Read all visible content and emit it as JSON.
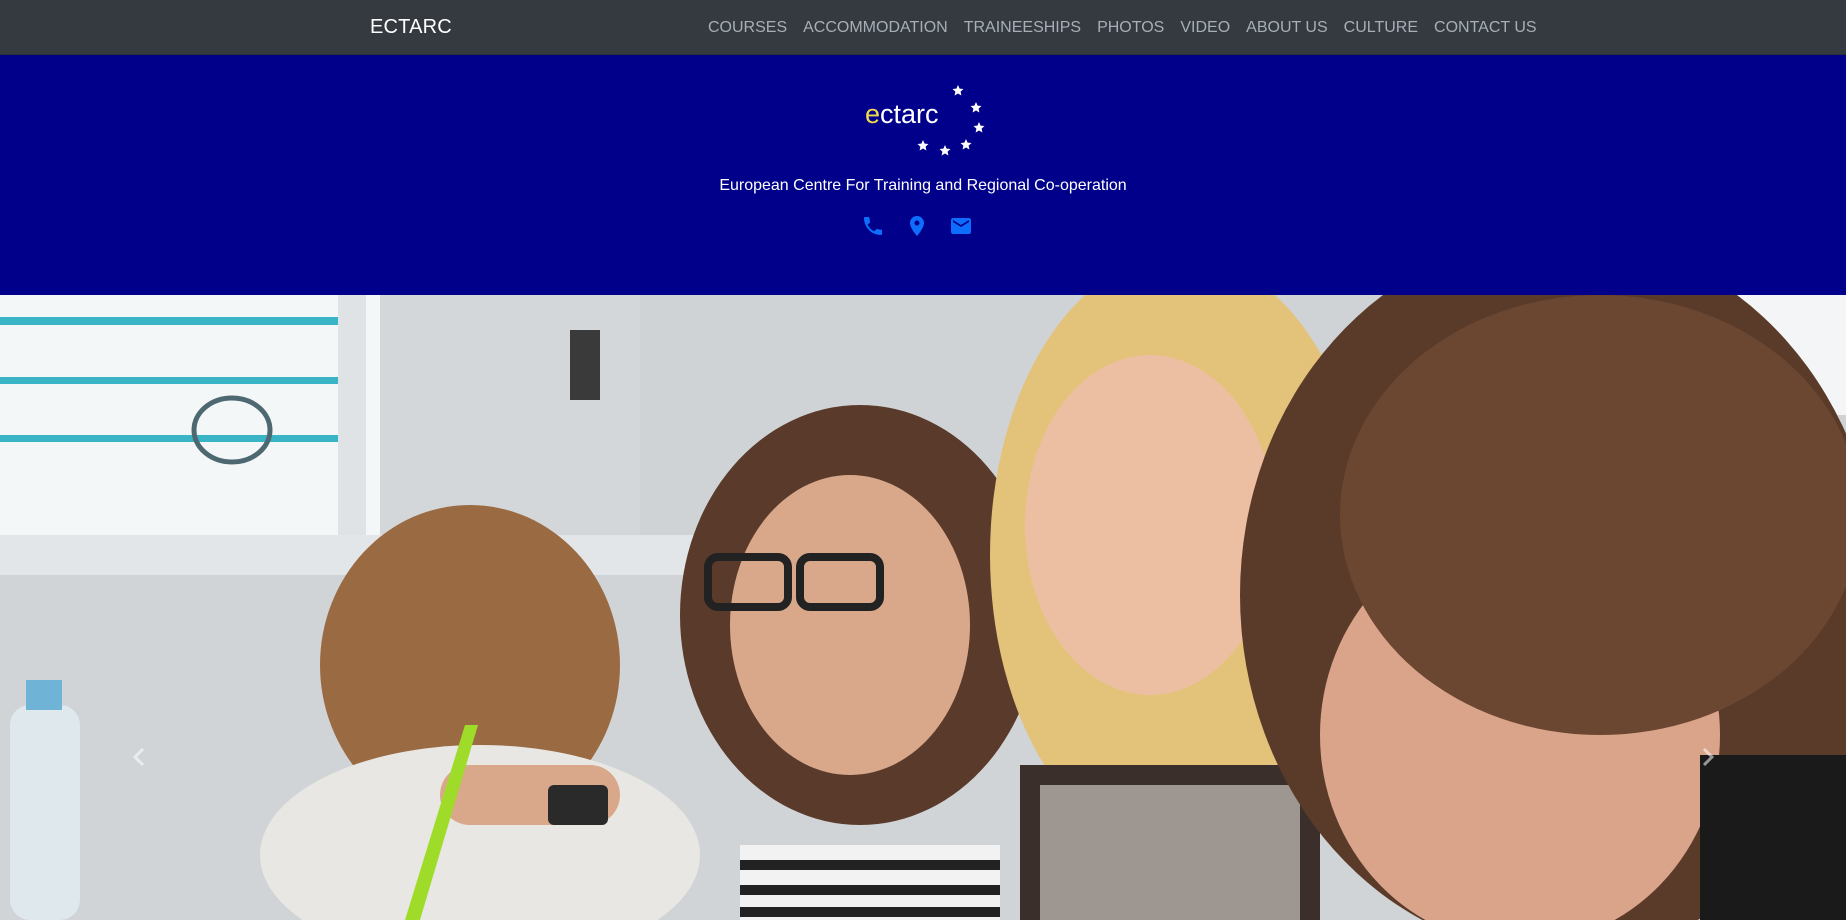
{
  "navbar": {
    "brand": "ECTARC",
    "items": [
      {
        "label": "COURSES"
      },
      {
        "label": "ACCOMMODATION"
      },
      {
        "label": "TRAINEESHIPS"
      },
      {
        "label": "PHOTOS"
      },
      {
        "label": "VIDEO"
      },
      {
        "label": "ABOUT US"
      },
      {
        "label": "CULTURE"
      },
      {
        "label": "CONTACT US"
      }
    ]
  },
  "header": {
    "logo": {
      "first_letter": "e",
      "rest": "ctarc",
      "icon": "eu-stars-logo"
    },
    "tagline": "European Centre For Training and Regional Co-operation",
    "contact_icons": [
      "phone-icon",
      "location-pin-icon",
      "mail-icon"
    ]
  },
  "carousel": {
    "image": "students-smiling-in-classroom-photo",
    "controls": [
      "chevron-left-icon",
      "chevron-right-icon"
    ]
  },
  "colors": {
    "navbar_bg": "#343a40",
    "header_bg": "#00008b",
    "nav_text": "#a7aeb6",
    "icon_blue": "#0d6efd",
    "logo_accent": "#f2d94e"
  }
}
